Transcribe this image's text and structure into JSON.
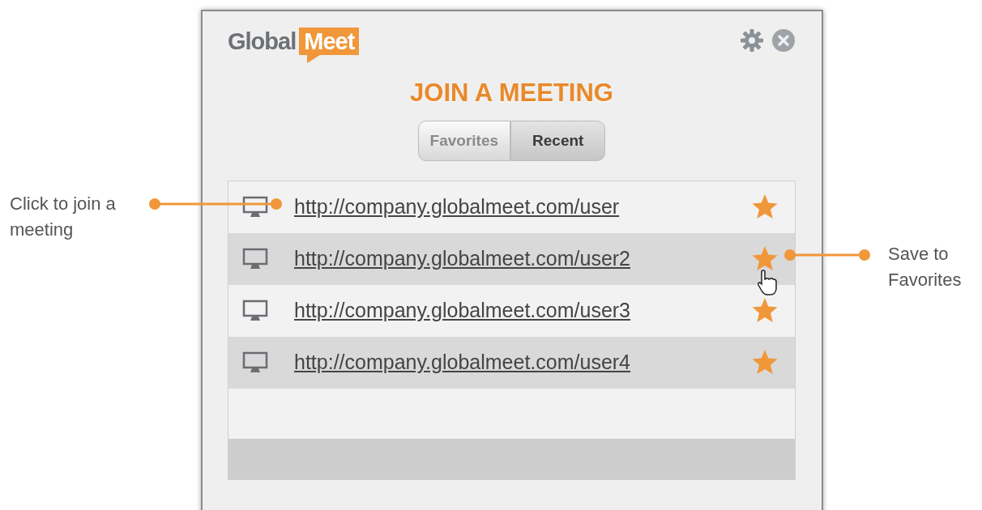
{
  "logo": {
    "left": "Global",
    "right": "Meet"
  },
  "title": "JOIN A MEETING",
  "tabs": [
    {
      "label": "Favorites",
      "selected": false
    },
    {
      "label": "Recent",
      "selected": true
    }
  ],
  "meetings": [
    {
      "url": "http://company.globalmeet.com/user"
    },
    {
      "url": "http://company.globalmeet.com/user2"
    },
    {
      "url": "http://company.globalmeet.com/user3"
    },
    {
      "url": "http://company.globalmeet.com/user4"
    }
  ],
  "callouts": [
    {
      "text": "Click to join a meeting",
      "kind": "left"
    },
    {
      "text": "Save to Favorites",
      "kind": "right"
    }
  ]
}
